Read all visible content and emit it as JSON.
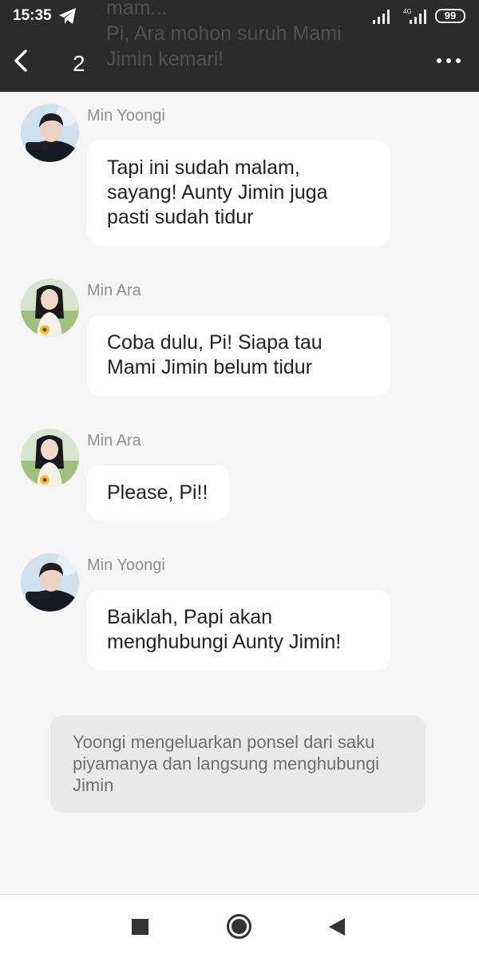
{
  "status_bar": {
    "time": "15:35",
    "network_label": "4G",
    "battery": "99",
    "icons": [
      "telegram-icon",
      "signal-icon",
      "signal-4g-icon"
    ]
  },
  "header": {
    "overlay_text": [
      "mam...",
      "Pi, Ara mohon suruh Mami",
      "Jimin kemari!"
    ],
    "page_number": "2",
    "icons": [
      "back-icon",
      "more-icon"
    ]
  },
  "messages": [
    {
      "sender": "Min Yoongi",
      "avatar": "yoongi-avatar",
      "lines": [
        "Tapi ini sudah malam,",
        "sayang! Aunty Jimin juga",
        "pasti sudah tidur"
      ]
    },
    {
      "sender": "Min Ara",
      "avatar": "ara-avatar",
      "lines": [
        "Coba dulu, Pi! Siapa tau",
        "Mami Jimin belum tidur"
      ]
    },
    {
      "sender": "Min Ara",
      "avatar": "ara-avatar",
      "lines": [
        "Please, Pi!!"
      ]
    },
    {
      "sender": "Min Yoongi",
      "avatar": "yoongi-avatar",
      "lines": [
        "Baiklah, Papi akan",
        "menghubungi Aunty Jimin!"
      ]
    }
  ],
  "narration": {
    "lines": [
      "Yoongi mengeluarkan ponsel dari saku",
      "piyamanya dan langsung menghubungi",
      "Jimin"
    ]
  },
  "nav_bar": {
    "icons": [
      "recents-square-icon",
      "home-circle-icon",
      "back-triangle-icon"
    ]
  },
  "colors": {
    "header_bg": "#2b2b2b",
    "page_bg": "#f6f6f6",
    "bubble_bg": "#ffffff",
    "narration_bg": "#e9e9e9",
    "sender_name": "#8f8f8f"
  }
}
